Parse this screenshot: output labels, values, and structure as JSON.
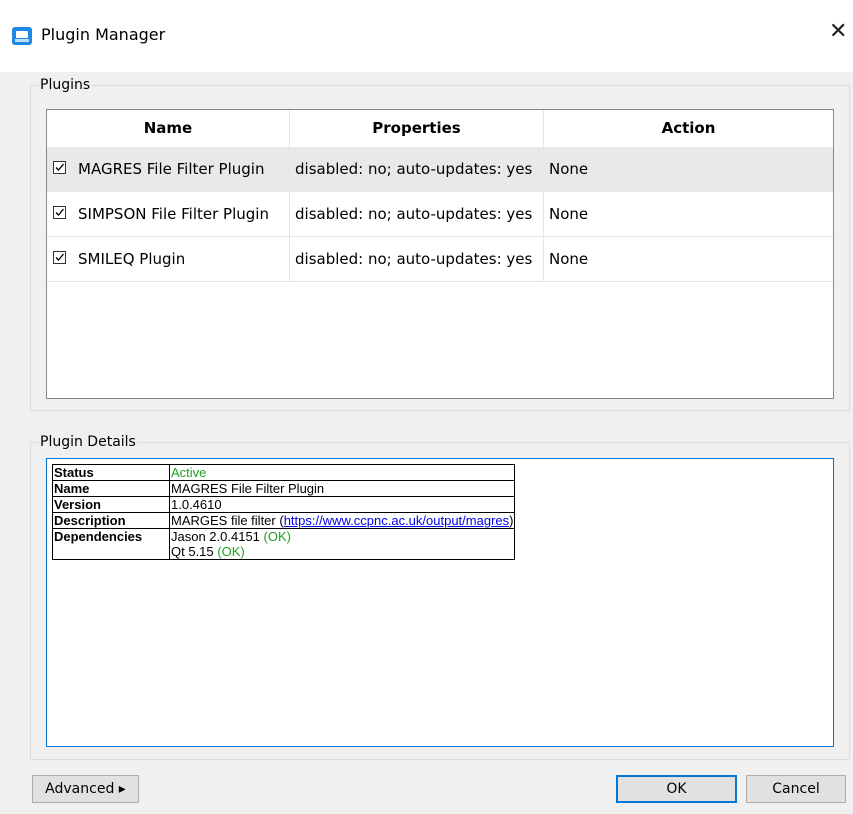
{
  "window": {
    "title": "Plugin Manager",
    "close_glyph": "✕",
    "icon": "app-icon"
  },
  "plugins_group": {
    "title": "Plugins",
    "columns": [
      "Name",
      "Properties",
      "Action"
    ],
    "rows": [
      {
        "checked": true,
        "name": "MAGRES File Filter Plugin",
        "properties": "disabled: no; auto-updates: yes",
        "action": "None",
        "selected": true
      },
      {
        "checked": true,
        "name": "SIMPSON File Filter Plugin",
        "properties": "disabled: no; auto-updates: yes",
        "action": "None",
        "selected": false
      },
      {
        "checked": true,
        "name": "SMILEQ Plugin",
        "properties": "disabled: no; auto-updates: yes",
        "action": "None",
        "selected": false
      }
    ]
  },
  "details_group": {
    "title": "Plugin Details",
    "status_label": "Status",
    "status_value": "Active",
    "name_label": "Name",
    "name_value": "MAGRES File Filter Plugin",
    "version_label": "Version",
    "version_value": "1.0.4610",
    "description_label": "Description",
    "description_prefix": "MARGES file filter (",
    "description_link": "https://www.ccpnc.ac.uk/output/magres",
    "description_suffix": ")",
    "dependencies_label": "Dependencies",
    "dependencies": [
      {
        "name": "Jason 2.0.4151",
        "status": "(OK)"
      },
      {
        "name": "Qt 5.15",
        "status": "(OK)"
      }
    ]
  },
  "buttons": {
    "advanced": "Advanced ▸",
    "ok": "OK",
    "cancel": "Cancel"
  },
  "colors": {
    "accent": "#0078d7",
    "ok_green": "#22a022",
    "link": "#0000ee"
  }
}
